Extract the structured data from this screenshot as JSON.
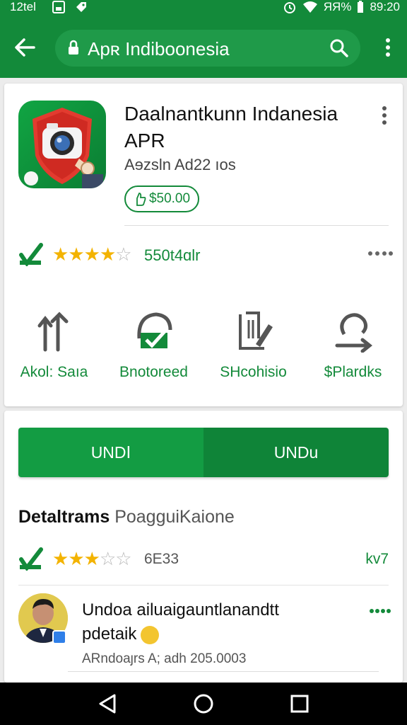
{
  "status_bar": {
    "time_left": "12tel",
    "battery_text": "ЯЯ%",
    "time_right": "89:20"
  },
  "app_bar": {
    "search_text": "Apʀ Indiboonesia",
    "icons": [
      "back-arrow-icon",
      "lock-icon",
      "search-icon",
      "overflow-menu-icon"
    ]
  },
  "app": {
    "title": "Daalnantkunn Indanesia APR",
    "subtitle": "Aɘzsln Ad22 ıos",
    "price": "$50.00"
  },
  "rating": {
    "stars": 4,
    "text": "550t4ɑlr"
  },
  "actions": [
    {
      "label": "Akol: Saıa",
      "icon": "share-arrows-icon"
    },
    {
      "label": "Bnotoreed",
      "icon": "bookmark-check-icon"
    },
    {
      "label": "SHcohisio",
      "icon": "edit-document-icon"
    },
    {
      "label": "$Plardks",
      "icon": "refresh-icon"
    }
  ],
  "buttons": {
    "left_label": "UNDꓲ",
    "right_label": "UNDu"
  },
  "details": {
    "heading": "Detaltrams",
    "subheading": "PoagguiKaione"
  },
  "rating2": {
    "stars": 3,
    "text": "6E33",
    "link": "kv7"
  },
  "review": {
    "title": "Undoa ailuaigauntlanandtt",
    "line2": "pdetaik",
    "meta": "ARndoaȷrs A; adh 205.0003"
  },
  "colors": {
    "primary": "#138a3a",
    "button_left": "#139c43",
    "button_right": "#0f8438",
    "star": "#f3b300"
  }
}
